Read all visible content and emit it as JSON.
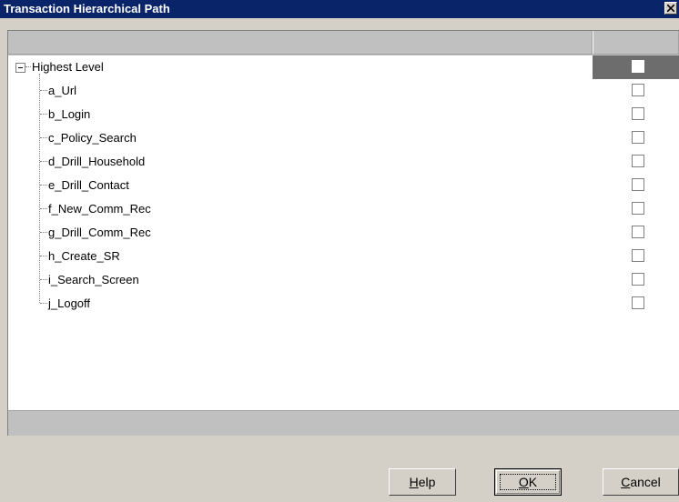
{
  "window": {
    "title": "Transaction Hierarchical Path"
  },
  "tree": {
    "root_label": "Highest Level",
    "items": [
      {
        "label": "a_Url"
      },
      {
        "label": "b_Login"
      },
      {
        "label": "c_Policy_Search"
      },
      {
        "label": "d_Drill_Household"
      },
      {
        "label": "e_Drill_Contact"
      },
      {
        "label": "f_New_Comm_Rec"
      },
      {
        "label": "g_Drill_Comm_Rec"
      },
      {
        "label": "h_Create_SR"
      },
      {
        "label": "i_Search_Screen"
      },
      {
        "label": "j_Logoff"
      }
    ]
  },
  "buttons": {
    "help": {
      "mnemonic": "H",
      "rest": "elp"
    },
    "ok": {
      "mnemonic": "O",
      "rest": "K"
    },
    "cancel": {
      "mnemonic": "C",
      "rest": "ancel"
    }
  }
}
